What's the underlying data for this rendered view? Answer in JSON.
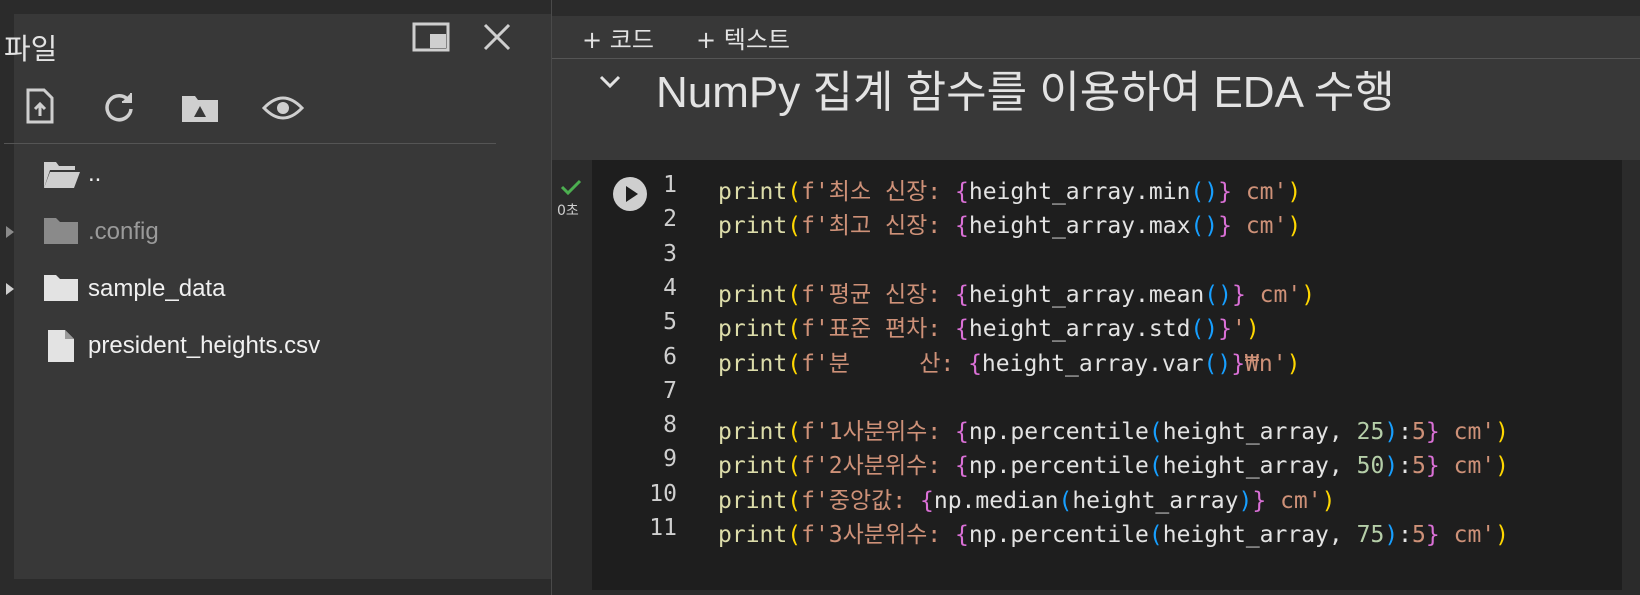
{
  "sidebar": {
    "title": "파일",
    "tree": [
      {
        "label": "..",
        "kind": "parent"
      },
      {
        "label": ".config",
        "kind": "folder"
      },
      {
        "label": "sample_data",
        "kind": "folder"
      },
      {
        "label": "president_heights.csv",
        "kind": "file"
      }
    ]
  },
  "toolbar": {
    "add_code": "+ 코드",
    "add_text": "+ 텍스트"
  },
  "section": {
    "heading": "NumPy 집계 함수를 이용하여 EDA 수행"
  },
  "cell": {
    "status": "0초",
    "lines": [
      {
        "n": "1",
        "parts": [
          [
            "kw",
            "print"
          ],
          [
            "br1",
            "("
          ],
          [
            "str",
            "f'최소 신장: "
          ],
          [
            "br2",
            "{"
          ],
          [
            "tx",
            "height_array.min"
          ],
          [
            "br3",
            "()"
          ],
          [
            "br2",
            "}"
          ],
          [
            "str",
            " cm'"
          ],
          [
            "br1",
            ")"
          ]
        ]
      },
      {
        "n": "2",
        "parts": [
          [
            "kw",
            "print"
          ],
          [
            "br1",
            "("
          ],
          [
            "str",
            "f'최고 신장: "
          ],
          [
            "br2",
            "{"
          ],
          [
            "tx",
            "height_array.max"
          ],
          [
            "br3",
            "()"
          ],
          [
            "br2",
            "}"
          ],
          [
            "str",
            " cm'"
          ],
          [
            "br1",
            ")"
          ]
        ]
      },
      {
        "n": "3",
        "parts": []
      },
      {
        "n": "4",
        "parts": [
          [
            "kw",
            "print"
          ],
          [
            "br1",
            "("
          ],
          [
            "str",
            "f'평균 신장: "
          ],
          [
            "br2",
            "{"
          ],
          [
            "tx",
            "height_array.mean"
          ],
          [
            "br3",
            "()"
          ],
          [
            "br2",
            "}"
          ],
          [
            "str",
            " cm'"
          ],
          [
            "br1",
            ")"
          ]
        ]
      },
      {
        "n": "5",
        "parts": [
          [
            "kw",
            "print"
          ],
          [
            "br1",
            "("
          ],
          [
            "str",
            "f'표준 편차: "
          ],
          [
            "br2",
            "{"
          ],
          [
            "tx",
            "height_array.std"
          ],
          [
            "br3",
            "()"
          ],
          [
            "br2",
            "}"
          ],
          [
            "str",
            "'"
          ],
          [
            "br1",
            ")"
          ]
        ]
      },
      {
        "n": "6",
        "parts": [
          [
            "kw",
            "print"
          ],
          [
            "br1",
            "("
          ],
          [
            "str",
            "f'분     산: "
          ],
          [
            "br2",
            "{"
          ],
          [
            "tx",
            "height_array.var"
          ],
          [
            "br3",
            "()"
          ],
          [
            "br2",
            "}"
          ],
          [
            "str",
            "₩n'"
          ],
          [
            "br1",
            ")"
          ]
        ]
      },
      {
        "n": "7",
        "parts": []
      },
      {
        "n": "8",
        "parts": [
          [
            "kw",
            "print"
          ],
          [
            "br1",
            "("
          ],
          [
            "str",
            "f'1사분위수: "
          ],
          [
            "br2",
            "{"
          ],
          [
            "tx",
            "np.percentile"
          ],
          [
            "br3",
            "("
          ],
          [
            "tx",
            "height_array, "
          ],
          [
            "num",
            "25"
          ],
          [
            "br3",
            ")"
          ],
          [
            "tx",
            ":"
          ],
          [
            "str",
            "5"
          ],
          [
            "br2",
            "}"
          ],
          [
            "str",
            " cm'"
          ],
          [
            "br1",
            ")"
          ]
        ]
      },
      {
        "n": "9",
        "parts": [
          [
            "kw",
            "print"
          ],
          [
            "br1",
            "("
          ],
          [
            "str",
            "f'2사분위수: "
          ],
          [
            "br2",
            "{"
          ],
          [
            "tx",
            "np.percentile"
          ],
          [
            "br3",
            "("
          ],
          [
            "tx",
            "height_array, "
          ],
          [
            "num",
            "50"
          ],
          [
            "br3",
            ")"
          ],
          [
            "tx",
            ":"
          ],
          [
            "str",
            "5"
          ],
          [
            "br2",
            "}"
          ],
          [
            "str",
            " cm'"
          ],
          [
            "br1",
            ")"
          ]
        ]
      },
      {
        "n": "10",
        "parts": [
          [
            "kw",
            "print"
          ],
          [
            "br1",
            "("
          ],
          [
            "str",
            "f'중앙값: "
          ],
          [
            "br2",
            "{"
          ],
          [
            "tx",
            "np.median"
          ],
          [
            "br3",
            "("
          ],
          [
            "tx",
            "height_array"
          ],
          [
            "br3",
            ")"
          ],
          [
            "br2",
            "}"
          ],
          [
            "str",
            " cm'"
          ],
          [
            "br1",
            ")"
          ]
        ]
      },
      {
        "n": "11",
        "parts": [
          [
            "kw",
            "print"
          ],
          [
            "br1",
            "("
          ],
          [
            "str",
            "f'3사분위수: "
          ],
          [
            "br2",
            "{"
          ],
          [
            "tx",
            "np.percentile"
          ],
          [
            "br3",
            "("
          ],
          [
            "tx",
            "height_array, "
          ],
          [
            "num",
            "75"
          ],
          [
            "br3",
            ")"
          ],
          [
            "tx",
            ":"
          ],
          [
            "str",
            "5"
          ],
          [
            "br2",
            "}"
          ],
          [
            "str",
            " cm'"
          ],
          [
            "br1",
            ")"
          ]
        ]
      }
    ]
  },
  "icons": {
    "upload": "upload-file-icon",
    "refresh": "refresh-icon",
    "drive": "google-drive-icon",
    "eye": "eye-icon",
    "window": "window-icon",
    "close": "close-icon"
  }
}
